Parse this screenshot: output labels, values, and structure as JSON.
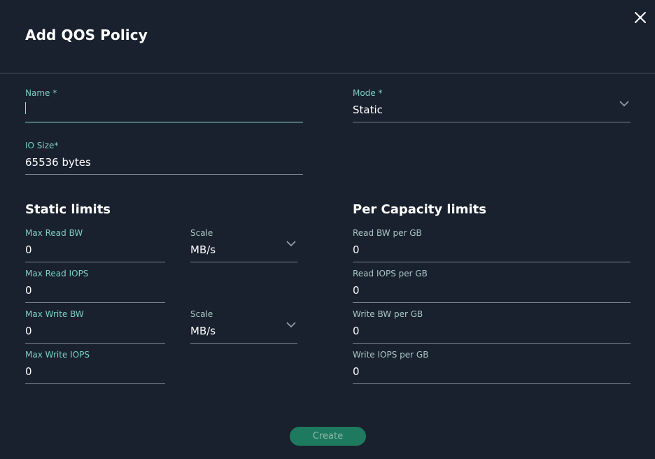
{
  "dialog": {
    "title": "Add QOS Policy",
    "close_icon": "close-icon"
  },
  "name": {
    "label": "Name *",
    "value": ""
  },
  "mode": {
    "label": "Mode *",
    "value": "Static"
  },
  "io_size": {
    "label": "IO Size*",
    "value": "65536 bytes"
  },
  "static_limits": {
    "heading": "Static limits",
    "max_read_bw": {
      "label": "Max Read BW",
      "value": "0"
    },
    "read_scale": {
      "label": "Scale",
      "value": "MB/s"
    },
    "max_read_iops": {
      "label": "Max Read IOPS",
      "value": "0"
    },
    "max_write_bw": {
      "label": "Max Write BW",
      "value": "0"
    },
    "write_scale": {
      "label": "Scale",
      "value": "MB/s"
    },
    "max_write_iops": {
      "label": "Max Write IOPS",
      "value": "0"
    }
  },
  "per_capacity_limits": {
    "heading": "Per Capacity limits",
    "read_bw_per_gb": {
      "label": "Read BW per GB",
      "value": "0"
    },
    "read_iops_per_gb": {
      "label": "Read IOPS per GB",
      "value": "0"
    },
    "write_bw_per_gb": {
      "label": "Write BW per GB",
      "value": "0"
    },
    "write_iops_per_gb": {
      "label": "Write IOPS per GB",
      "value": "0"
    }
  },
  "actions": {
    "create_label": "Create"
  },
  "colors": {
    "background": "#19212e",
    "label_accent": "#7ccfc0",
    "create_button": "#1e7a5e"
  }
}
